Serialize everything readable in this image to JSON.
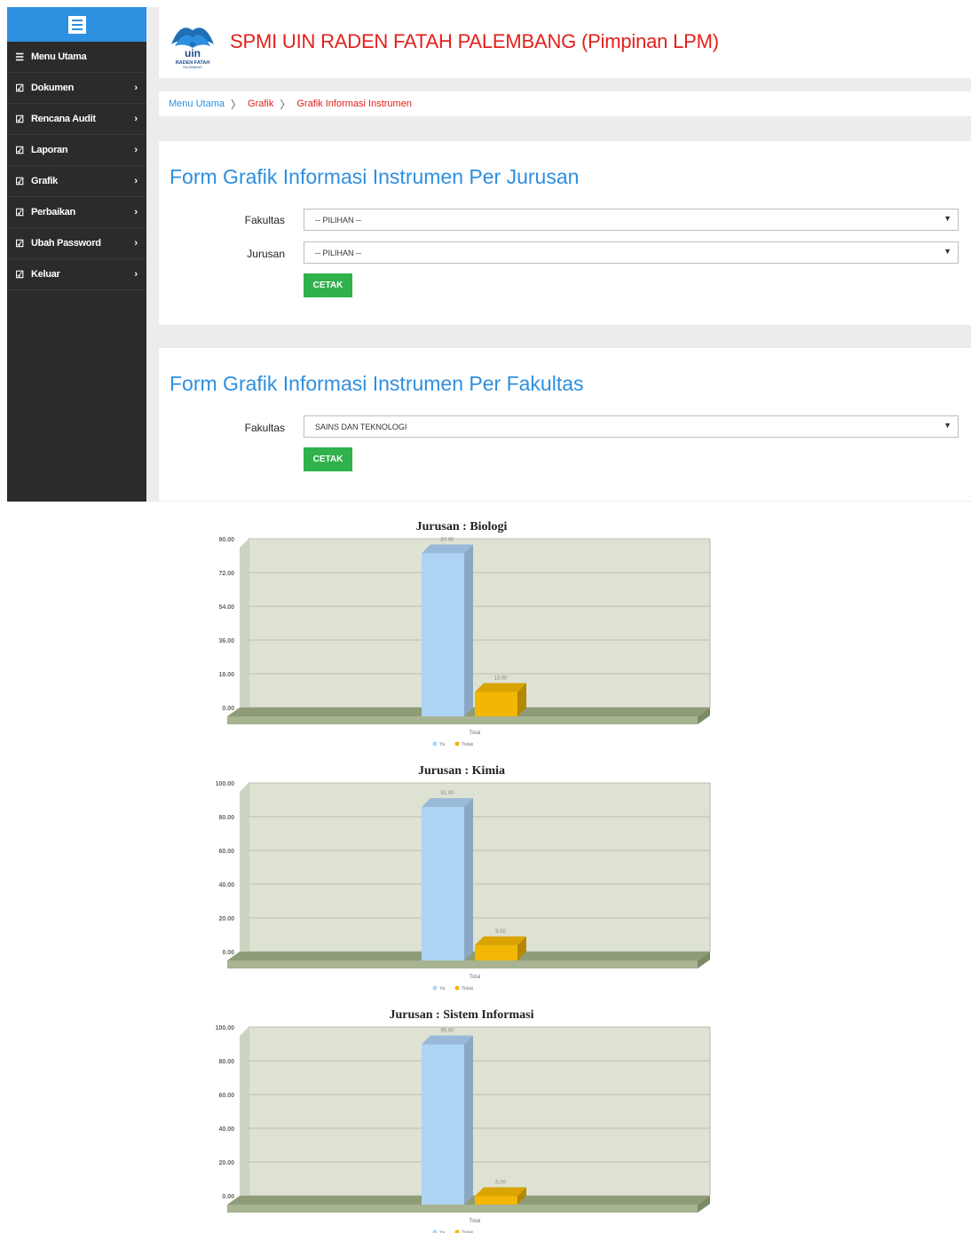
{
  "app": {
    "title": "SPMI UIN RADEN FATAH PALEMBANG (Pimpinan LPM)",
    "logo_text": "uin",
    "logo_sub": "RADEN FATAH",
    "logo_sub2": "PALEMBANG"
  },
  "sidebar": {
    "items": [
      {
        "label": "Menu Utama",
        "icon": "list-icon",
        "has_chevron": false
      },
      {
        "label": "Dokumen",
        "icon": "check-square-icon",
        "has_chevron": true
      },
      {
        "label": "Rencana Audit",
        "icon": "check-square-icon",
        "has_chevron": true
      },
      {
        "label": "Laporan",
        "icon": "check-square-icon",
        "has_chevron": true
      },
      {
        "label": "Grafik",
        "icon": "check-square-icon",
        "has_chevron": true
      },
      {
        "label": "Perbaikan",
        "icon": "check-square-icon",
        "has_chevron": true
      },
      {
        "label": "Ubah Password",
        "icon": "check-square-icon",
        "has_chevron": true
      },
      {
        "label": "Keluar",
        "icon": "check-square-icon",
        "has_chevron": true
      }
    ]
  },
  "breadcrumb": {
    "home": "Menu Utama",
    "section": "Grafik",
    "current": "Grafik Informasi Instrumen",
    "sep": "〉"
  },
  "form_jurusan": {
    "title": "Form Grafik Informasi Instrumen Per Jurusan",
    "fakultas_label": "Fakultas",
    "fakultas_value": "-- PILIHAN --",
    "jurusan_label": "Jurusan",
    "jurusan_value": "-- PILIHAN --",
    "button": "CETAK"
  },
  "form_fakultas": {
    "title": "Form Grafik Informasi Instrumen Per Fakultas",
    "fakultas_label": "Fakultas",
    "fakultas_value": "SAINS DAN TEKNOLOGI",
    "button": "CETAK"
  },
  "colors": {
    "accent": "#2d8fe0",
    "title_red": "#e3201b",
    "button_green": "#2fb24c",
    "sidebar": "#2b2b2b",
    "series_ya": "#aed4f5",
    "series_tidak": "#f2b705"
  },
  "chart_data": [
    {
      "type": "bar",
      "title": "Jurusan : Biologi",
      "categories": [
        "Total"
      ],
      "ylim": [
        0,
        90
      ],
      "yticks": [
        "0.00",
        "18.00",
        "36.00",
        "54.00",
        "72.00",
        "90.00"
      ],
      "series": [
        {
          "name": "Ya",
          "values": [
            87
          ],
          "label": "87.00"
        },
        {
          "name": "Tidak",
          "values": [
            13
          ],
          "label": "13.00"
        }
      ]
    },
    {
      "type": "bar",
      "title": "Jurusan : Kimia",
      "categories": [
        "Total"
      ],
      "ylim": [
        0,
        100
      ],
      "yticks": [
        "0.00",
        "20.00",
        "40.00",
        "60.00",
        "80.00",
        "100.00"
      ],
      "series": [
        {
          "name": "Ya",
          "values": [
            91
          ],
          "label": "91.00"
        },
        {
          "name": "Tidak",
          "values": [
            9
          ],
          "label": "9.00"
        }
      ]
    },
    {
      "type": "bar",
      "title": "Jurusan : Sistem Informasi",
      "categories": [
        "Total"
      ],
      "ylim": [
        0,
        100
      ],
      "yticks": [
        "0.00",
        "20.00",
        "40.00",
        "60.00",
        "80.00",
        "100.00"
      ],
      "series": [
        {
          "name": "Ya",
          "values": [
            95
          ],
          "label": "95.00"
        },
        {
          "name": "Tidak",
          "values": [
            5
          ],
          "label": "5.00"
        }
      ]
    }
  ]
}
